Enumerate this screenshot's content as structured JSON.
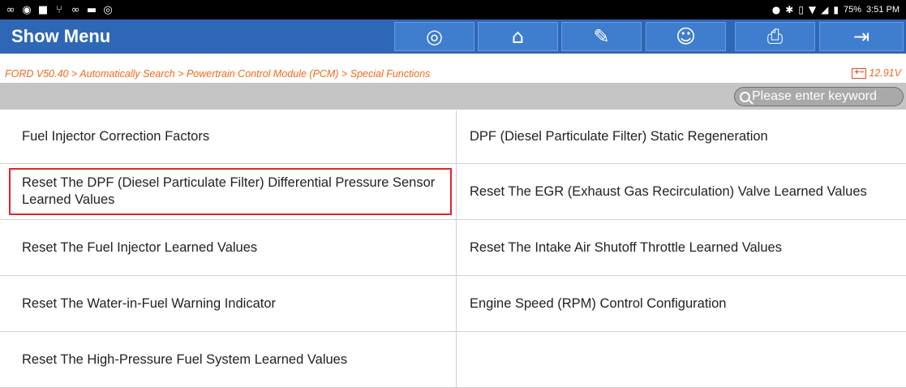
{
  "status_bar": {
    "left_icons": [
      "link-icon",
      "app-icon",
      "image-icon",
      "usb-icon",
      "link-icon",
      "video-icon",
      "wireless-icon"
    ],
    "battery_percent": "75%",
    "time": "3:51 PM"
  },
  "toolbar": {
    "title": "Show Menu",
    "buttons": [
      {
        "name": "steering-wheel-button",
        "icon": "steering-wheel-icon"
      },
      {
        "name": "home-button",
        "icon": "home-icon"
      },
      {
        "name": "edit-report-button",
        "icon": "edit-icon"
      },
      {
        "name": "user-button",
        "icon": "user-icon"
      },
      {
        "name": "print-button",
        "icon": "printer-icon"
      },
      {
        "name": "exit-button",
        "icon": "exit-icon"
      }
    ]
  },
  "breadcrumb": {
    "path": "FORD V50.40 > Automatically Search > Powertrain Control Module (PCM) > Special Functions",
    "voltage": "12.91V",
    "accent_color": "#ee6a1b"
  },
  "search": {
    "placeholder": "Please enter keyword",
    "value": ""
  },
  "menu": {
    "rows": [
      {
        "left": "Fuel Injector Correction Factors",
        "right": "DPF (Diesel Particulate Filter) Static Regeneration"
      },
      {
        "left": "Reset The DPF (Diesel Particulate Filter) Differential Pressure Sensor Learned Values",
        "right": "Reset The EGR (Exhaust Gas Recirculation) Valve Learned Values",
        "left_highlighted": true
      },
      {
        "left": "Reset The Fuel Injector Learned Values",
        "right": "Reset The Intake Air Shutoff Throttle Learned Values"
      },
      {
        "left": "Reset The Water-in-Fuel Warning Indicator",
        "right": "Engine Speed (RPM) Control Configuration"
      },
      {
        "left": "Reset The High-Pressure Fuel System Learned Values",
        "right": ""
      }
    ],
    "highlight_color": "#e0242c"
  },
  "colors": {
    "header_bg": "#2e67b5",
    "button_bg": "#3f7ecf",
    "searchbar_bg": "#c5c5c5"
  }
}
